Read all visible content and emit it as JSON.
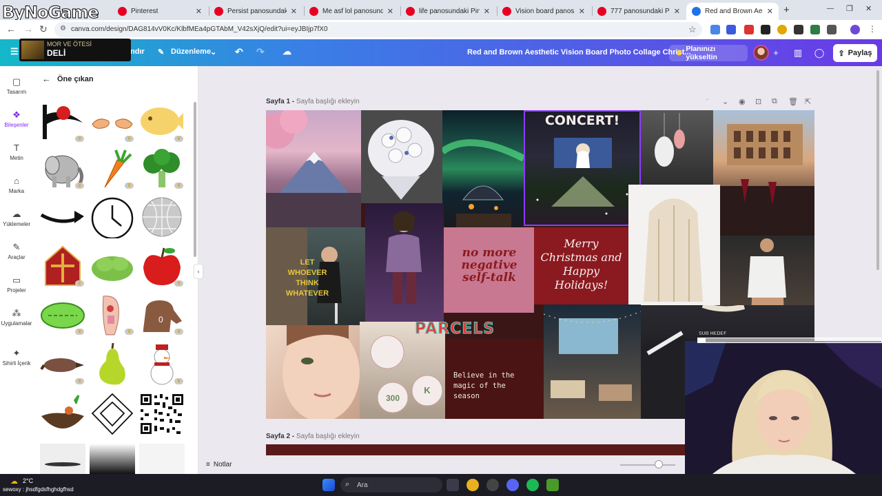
{
  "overlay": {
    "logo": "ByNoGame",
    "now_playing": {
      "artist": "MOR VE ÖTESİ",
      "song": "DELİ"
    }
  },
  "browser": {
    "tabs": [
      {
        "label": "Pinterest"
      },
      {
        "label": "Persist panosundaki Pin"
      },
      {
        "label": "Me asf lol panosundaki P"
      },
      {
        "label": "life panosundaki Pin"
      },
      {
        "label": "Vision board panosunda"
      },
      {
        "label": "777 panosundaki Pin"
      },
      {
        "label": "Red and Brown Aesthetic"
      }
    ],
    "url": "canva.com/design/DAG814vV0Kc/KlbfMEa4pGTAbM_V42sXjQ/edit?ui=eyJBIjp7fX0",
    "accent": "#1f73ea"
  },
  "canva_header": {
    "file_label": "ndır",
    "edit_label": "Düzenleme",
    "title": "Red and Brown Aesthetic Vision Board Photo Collage Christ...",
    "upgrade_label": "Planınızı yükseltin",
    "share_label": "Paylaş"
  },
  "rail": [
    {
      "label": "Tasarım",
      "icon": "layout-icon"
    },
    {
      "label": "Bileşenler",
      "icon": "shapes-icon"
    },
    {
      "label": "Metin",
      "icon": "text-icon"
    },
    {
      "label": "Marka",
      "icon": "brand-icon"
    },
    {
      "label": "Yüklemeler",
      "icon": "cloud-upload-icon"
    },
    {
      "label": "Araçlar",
      "icon": "pen-icon"
    },
    {
      "label": "Projeler",
      "icon": "folder-icon"
    },
    {
      "label": "Uygulamalar",
      "icon": "apps-icon"
    },
    {
      "label": "Sihirli İçerik",
      "icon": "magic-icon"
    }
  ],
  "panel": {
    "title": "Öne çıkan",
    "elements": [
      "flag-graphic",
      "hands-graphic",
      "fish-bread-graphic",
      "elephant-graphic",
      "carrot-graphic",
      "broccoli-graphic",
      "arrow-graphic",
      "clock-graphic",
      "disco-ball-graphic",
      "mitre-graphic",
      "bush-graphic",
      "apple-graphic",
      "chloroplast-graphic",
      "anatomy-graphic",
      "capybara-graphic",
      "platypus-graphic",
      "pear-graphic",
      "snowman-graphic",
      "nest-graphic",
      "ornament-graphic",
      "qr-code-graphic"
    ]
  },
  "canvas": {
    "page1_label": "Sayfa 1 -",
    "page1_placeholder": "Sayfa başlığı ekleyin",
    "page2_label": "Sayfa 2 -",
    "page2_placeholder": "Sayfa başlığı ekleyin",
    "tiles": {
      "concert": "CONCERT!",
      "let_whoever": "LET WHOEVER THINK WHATEVER",
      "no_more": "no more negative self-talk",
      "merry": "Merry Christmas and Happy Holidays!",
      "parcels": "PARCELS",
      "believe": "Believe in the magic of the season",
      "cookie1": "300",
      "cookie2": "K"
    }
  },
  "notes_label": "Notlar",
  "zoom_fraction": 0.7,
  "stream": {
    "sub_goal_label": "SUB HEDEF",
    "sub_goal_fraction": 0.04
  },
  "taskbar": {
    "weather": "2°C",
    "chat": "sewoxy : jhsdfgdsfhghdgfhsd",
    "chat_user": "sewoxy",
    "search_placeholder": "Ara"
  }
}
